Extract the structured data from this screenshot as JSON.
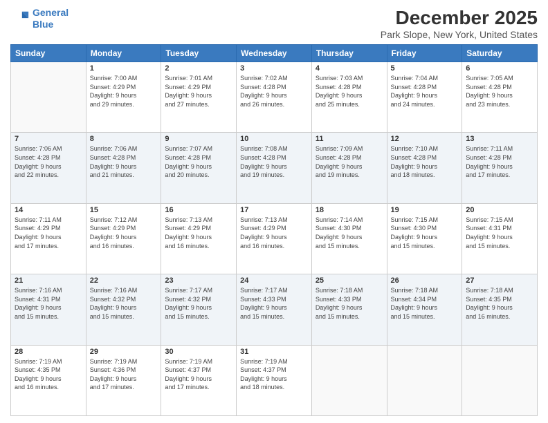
{
  "header": {
    "logo_line1": "General",
    "logo_line2": "Blue",
    "title": "December 2025",
    "subtitle": "Park Slope, New York, United States"
  },
  "days_of_week": [
    "Sunday",
    "Monday",
    "Tuesday",
    "Wednesday",
    "Thursday",
    "Friday",
    "Saturday"
  ],
  "weeks": [
    [
      {
        "day": "",
        "info": ""
      },
      {
        "day": "1",
        "info": "Sunrise: 7:00 AM\nSunset: 4:29 PM\nDaylight: 9 hours\nand 29 minutes."
      },
      {
        "day": "2",
        "info": "Sunrise: 7:01 AM\nSunset: 4:29 PM\nDaylight: 9 hours\nand 27 minutes."
      },
      {
        "day": "3",
        "info": "Sunrise: 7:02 AM\nSunset: 4:28 PM\nDaylight: 9 hours\nand 26 minutes."
      },
      {
        "day": "4",
        "info": "Sunrise: 7:03 AM\nSunset: 4:28 PM\nDaylight: 9 hours\nand 25 minutes."
      },
      {
        "day": "5",
        "info": "Sunrise: 7:04 AM\nSunset: 4:28 PM\nDaylight: 9 hours\nand 24 minutes."
      },
      {
        "day": "6",
        "info": "Sunrise: 7:05 AM\nSunset: 4:28 PM\nDaylight: 9 hours\nand 23 minutes."
      }
    ],
    [
      {
        "day": "7",
        "info": "Sunrise: 7:06 AM\nSunset: 4:28 PM\nDaylight: 9 hours\nand 22 minutes."
      },
      {
        "day": "8",
        "info": "Sunrise: 7:06 AM\nSunset: 4:28 PM\nDaylight: 9 hours\nand 21 minutes."
      },
      {
        "day": "9",
        "info": "Sunrise: 7:07 AM\nSunset: 4:28 PM\nDaylight: 9 hours\nand 20 minutes."
      },
      {
        "day": "10",
        "info": "Sunrise: 7:08 AM\nSunset: 4:28 PM\nDaylight: 9 hours\nand 19 minutes."
      },
      {
        "day": "11",
        "info": "Sunrise: 7:09 AM\nSunset: 4:28 PM\nDaylight: 9 hours\nand 19 minutes."
      },
      {
        "day": "12",
        "info": "Sunrise: 7:10 AM\nSunset: 4:28 PM\nDaylight: 9 hours\nand 18 minutes."
      },
      {
        "day": "13",
        "info": "Sunrise: 7:11 AM\nSunset: 4:28 PM\nDaylight: 9 hours\nand 17 minutes."
      }
    ],
    [
      {
        "day": "14",
        "info": "Sunrise: 7:11 AM\nSunset: 4:29 PM\nDaylight: 9 hours\nand 17 minutes."
      },
      {
        "day": "15",
        "info": "Sunrise: 7:12 AM\nSunset: 4:29 PM\nDaylight: 9 hours\nand 16 minutes."
      },
      {
        "day": "16",
        "info": "Sunrise: 7:13 AM\nSunset: 4:29 PM\nDaylight: 9 hours\nand 16 minutes."
      },
      {
        "day": "17",
        "info": "Sunrise: 7:13 AM\nSunset: 4:29 PM\nDaylight: 9 hours\nand 16 minutes."
      },
      {
        "day": "18",
        "info": "Sunrise: 7:14 AM\nSunset: 4:30 PM\nDaylight: 9 hours\nand 15 minutes."
      },
      {
        "day": "19",
        "info": "Sunrise: 7:15 AM\nSunset: 4:30 PM\nDaylight: 9 hours\nand 15 minutes."
      },
      {
        "day": "20",
        "info": "Sunrise: 7:15 AM\nSunset: 4:31 PM\nDaylight: 9 hours\nand 15 minutes."
      }
    ],
    [
      {
        "day": "21",
        "info": "Sunrise: 7:16 AM\nSunset: 4:31 PM\nDaylight: 9 hours\nand 15 minutes."
      },
      {
        "day": "22",
        "info": "Sunrise: 7:16 AM\nSunset: 4:32 PM\nDaylight: 9 hours\nand 15 minutes."
      },
      {
        "day": "23",
        "info": "Sunrise: 7:17 AM\nSunset: 4:32 PM\nDaylight: 9 hours\nand 15 minutes."
      },
      {
        "day": "24",
        "info": "Sunrise: 7:17 AM\nSunset: 4:33 PM\nDaylight: 9 hours\nand 15 minutes."
      },
      {
        "day": "25",
        "info": "Sunrise: 7:18 AM\nSunset: 4:33 PM\nDaylight: 9 hours\nand 15 minutes."
      },
      {
        "day": "26",
        "info": "Sunrise: 7:18 AM\nSunset: 4:34 PM\nDaylight: 9 hours\nand 15 minutes."
      },
      {
        "day": "27",
        "info": "Sunrise: 7:18 AM\nSunset: 4:35 PM\nDaylight: 9 hours\nand 16 minutes."
      }
    ],
    [
      {
        "day": "28",
        "info": "Sunrise: 7:19 AM\nSunset: 4:35 PM\nDaylight: 9 hours\nand 16 minutes."
      },
      {
        "day": "29",
        "info": "Sunrise: 7:19 AM\nSunset: 4:36 PM\nDaylight: 9 hours\nand 17 minutes."
      },
      {
        "day": "30",
        "info": "Sunrise: 7:19 AM\nSunset: 4:37 PM\nDaylight: 9 hours\nand 17 minutes."
      },
      {
        "day": "31",
        "info": "Sunrise: 7:19 AM\nSunset: 4:37 PM\nDaylight: 9 hours\nand 18 minutes."
      },
      {
        "day": "",
        "info": ""
      },
      {
        "day": "",
        "info": ""
      },
      {
        "day": "",
        "info": ""
      }
    ]
  ]
}
